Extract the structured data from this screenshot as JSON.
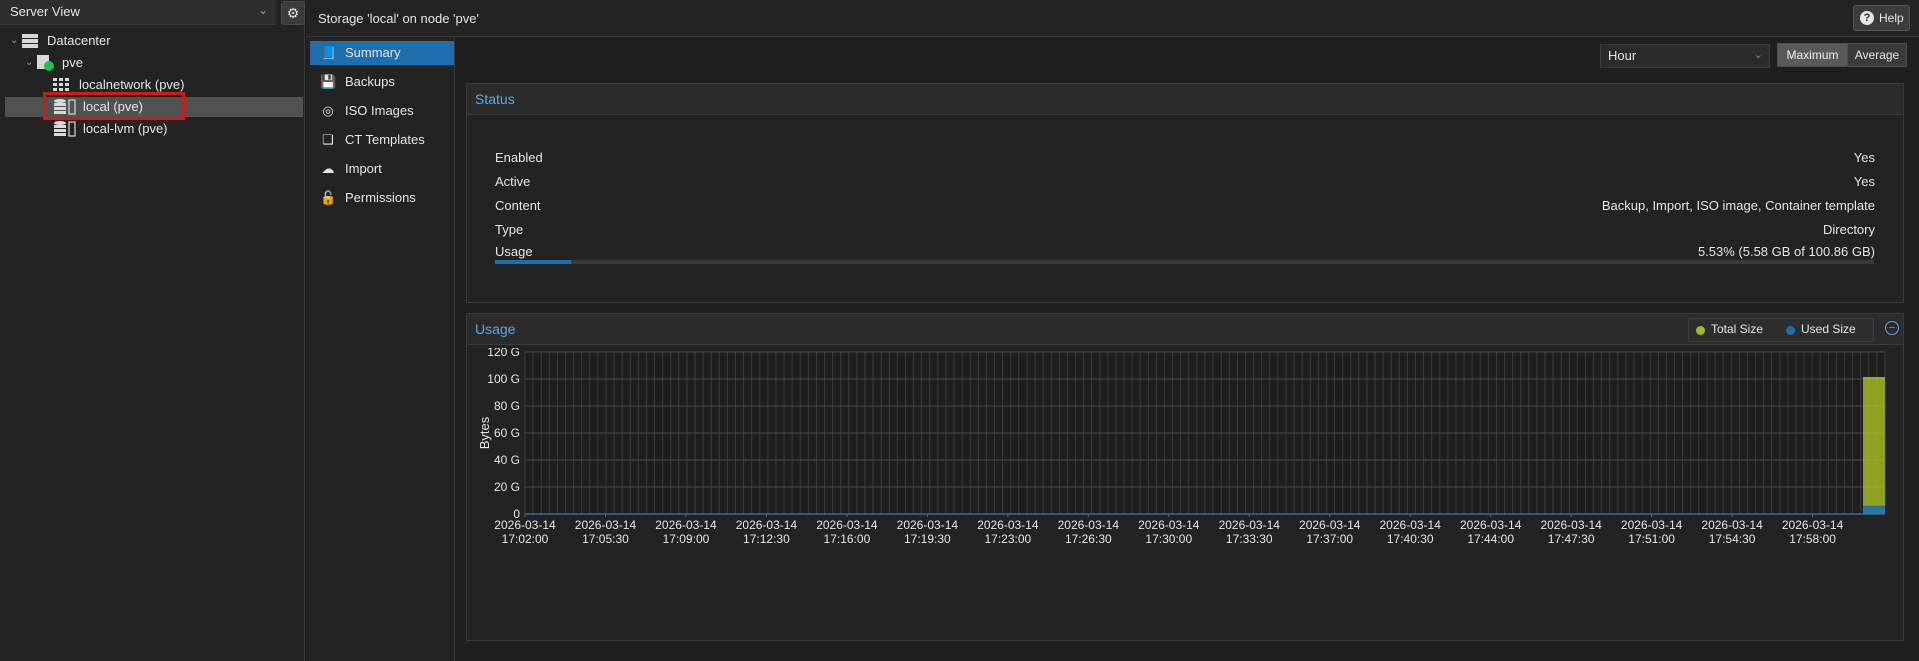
{
  "tree": {
    "view_label": "Server View",
    "items": [
      {
        "label": "Datacenter",
        "icon": "datacenter-icon"
      },
      {
        "label": "pve",
        "icon": "node-online-icon"
      },
      {
        "label": "localnetwork (pve)",
        "icon": "sdn-zone-icon"
      },
      {
        "label": "local (pve)",
        "icon": "storage-icon"
      },
      {
        "label": "local-lvm (pve)",
        "icon": "storage-icon"
      }
    ]
  },
  "header": {
    "title": "Storage 'local' on node 'pve'",
    "help_label": "Help"
  },
  "nav": {
    "items": [
      {
        "label": "Summary",
        "icon": "book-icon"
      },
      {
        "label": "Backups",
        "icon": "floppy-icon"
      },
      {
        "label": "ISO Images",
        "icon": "disc-icon"
      },
      {
        "label": "CT Templates",
        "icon": "template-icon"
      },
      {
        "label": "Import",
        "icon": "cloud-upload-icon"
      },
      {
        "label": "Permissions",
        "icon": "unlock-icon"
      }
    ]
  },
  "toolbar": {
    "timeframe": "Hour",
    "cf_max": "Maximum",
    "cf_avg": "Average"
  },
  "status": {
    "title": "Status",
    "rows": [
      {
        "key": "Enabled",
        "value": "Yes"
      },
      {
        "key": "Active",
        "value": "Yes"
      },
      {
        "key": "Content",
        "value": "Backup, Import, ISO image, Container template"
      },
      {
        "key": "Type",
        "value": "Directory"
      }
    ],
    "usage_label": "Usage",
    "usage_value": "5.53% (5.58 GB of 100.86 GB)",
    "usage_fraction": 0.0553
  },
  "usage_panel": {
    "title": "Usage",
    "legend": [
      {
        "label": "Total Size",
        "color": "#a4b823"
      },
      {
        "label": "Used Size",
        "color": "#1f6fb0"
      }
    ]
  },
  "chart_data": {
    "type": "area",
    "ylabel": "Bytes",
    "ylim": [
      0,
      120
    ],
    "yticks": [
      "0",
      "20 G",
      "40 G",
      "60 G",
      "80 G",
      "100 G",
      "120 G"
    ],
    "x_ticks": [
      [
        "2026-03-14",
        "17:02:00"
      ],
      [
        "2026-03-14",
        "17:05:30"
      ],
      [
        "2026-03-14",
        "17:09:00"
      ],
      [
        "2026-03-14",
        "17:12:30"
      ],
      [
        "2026-03-14",
        "17:16:00"
      ],
      [
        "2026-03-14",
        "17:19:30"
      ],
      [
        "2026-03-14",
        "17:23:00"
      ],
      [
        "2026-03-14",
        "17:26:30"
      ],
      [
        "2026-03-14",
        "17:30:00"
      ],
      [
        "2026-03-14",
        "17:33:30"
      ],
      [
        "2026-03-14",
        "17:37:00"
      ],
      [
        "2026-03-14",
        "17:40:30"
      ],
      [
        "2026-03-14",
        "17:44:00"
      ],
      [
        "2026-03-14",
        "17:47:30"
      ],
      [
        "2026-03-14",
        "17:51:00"
      ],
      [
        "2026-03-14",
        "17:54:30"
      ],
      [
        "2026-03-14",
        "17:58:00"
      ]
    ],
    "series": [
      {
        "name": "Total Size",
        "color": "#a4b823",
        "values_gb_last_interval": 100.86
      },
      {
        "name": "Used Size",
        "color": "#1f6fb0",
        "values_gb_last_interval": 5.58
      }
    ]
  }
}
